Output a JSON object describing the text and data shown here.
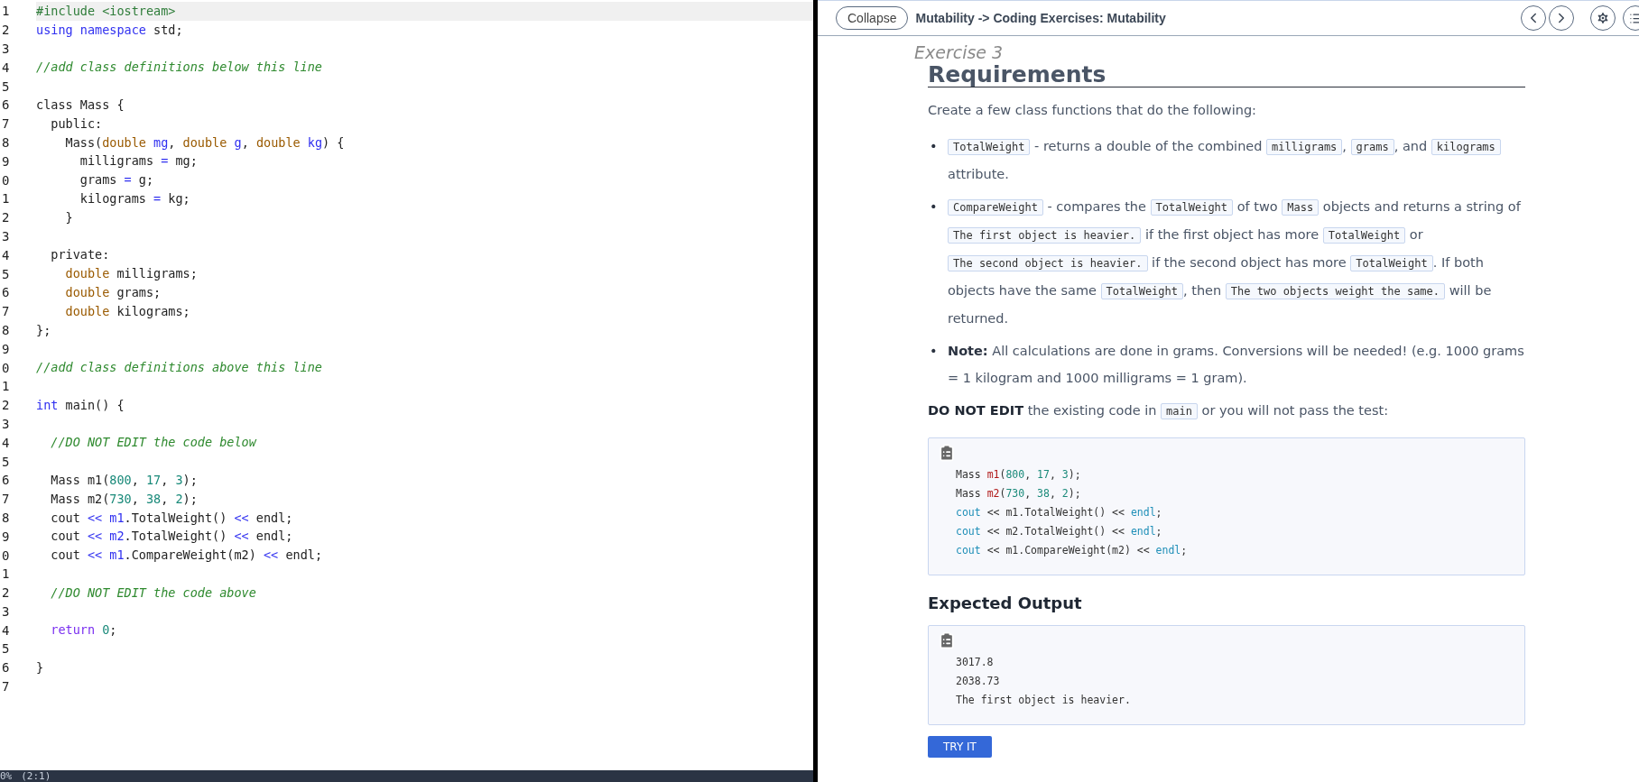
{
  "editor": {
    "lines": [
      {
        "number": "1",
        "highlighted": true,
        "tokens": [
          {
            "kind": "meta",
            "text": "#include <iostream>"
          }
        ]
      },
      {
        "number": "2",
        "highlighted": false,
        "tokens": [
          {
            "kind": "keyword",
            "text": "using namespace"
          },
          {
            "kind": "plain",
            "text": " std;"
          }
        ]
      },
      {
        "number": "3",
        "highlighted": false
      },
      {
        "number": "4",
        "highlighted": false,
        "tokens": [
          {
            "kind": "comment",
            "text": "//add class definitions below this line"
          }
        ]
      },
      {
        "number": "5",
        "highlighted": false
      },
      {
        "number": "6",
        "highlighted": false,
        "tokens": [
          {
            "kind": "plain",
            "text": "class Mass {"
          }
        ]
      },
      {
        "number": "7",
        "highlighted": false,
        "tokens": [
          {
            "kind": "plain",
            "text": "  public:"
          }
        ]
      },
      {
        "number": "8",
        "highlighted": false,
        "tokens": [
          {
            "kind": "plain",
            "text": "    Mass("
          },
          {
            "kind": "type",
            "text": "double"
          },
          {
            "kind": "keyword",
            "text": " mg"
          },
          {
            "kind": "plain",
            "text": ", "
          },
          {
            "kind": "type",
            "text": "double"
          },
          {
            "kind": "keyword",
            "text": " g"
          },
          {
            "kind": "plain",
            "text": ", "
          },
          {
            "kind": "type",
            "text": "double"
          },
          {
            "kind": "keyword",
            "text": " kg"
          },
          {
            "kind": "plain",
            "text": ") {"
          }
        ]
      },
      {
        "number": "9",
        "highlighted": false,
        "tokens": [
          {
            "kind": "plain",
            "text": "      milligrams "
          },
          {
            "kind": "keyword",
            "text": "="
          },
          {
            "kind": "plain",
            "text": " mg;"
          }
        ]
      },
      {
        "number": "0",
        "highlighted": false,
        "tokens": [
          {
            "kind": "plain",
            "text": "      grams "
          },
          {
            "kind": "keyword",
            "text": "="
          },
          {
            "kind": "plain",
            "text": " g;"
          }
        ]
      },
      {
        "number": "1",
        "highlighted": false,
        "tokens": [
          {
            "kind": "plain",
            "text": "      kilograms "
          },
          {
            "kind": "keyword",
            "text": "="
          },
          {
            "kind": "plain",
            "text": " kg;"
          }
        ]
      },
      {
        "number": "2",
        "highlighted": false,
        "tokens": [
          {
            "kind": "plain",
            "text": "    }"
          }
        ]
      },
      {
        "number": "3",
        "highlighted": false
      },
      {
        "number": "4",
        "highlighted": false,
        "tokens": [
          {
            "kind": "plain",
            "text": "  private:"
          }
        ]
      },
      {
        "number": "5",
        "highlighted": false,
        "tokens": [
          {
            "kind": "type",
            "text": "    double"
          },
          {
            "kind": "plain",
            "text": " milligrams;"
          }
        ]
      },
      {
        "number": "6",
        "highlighted": false,
        "tokens": [
          {
            "kind": "type",
            "text": "    double"
          },
          {
            "kind": "plain",
            "text": " grams;"
          }
        ]
      },
      {
        "number": "7",
        "highlighted": false,
        "tokens": [
          {
            "kind": "type",
            "text": "    double"
          },
          {
            "kind": "plain",
            "text": " kilograms;"
          }
        ]
      },
      {
        "number": "8",
        "highlighted": false,
        "tokens": [
          {
            "kind": "plain",
            "text": "};"
          }
        ]
      },
      {
        "number": "9",
        "highlighted": false
      },
      {
        "number": "0",
        "highlighted": false,
        "tokens": [
          {
            "kind": "comment",
            "text": "//add class definitions above this line"
          }
        ]
      },
      {
        "number": "1",
        "highlighted": false
      },
      {
        "number": "2",
        "highlighted": false,
        "tokens": [
          {
            "kind": "keyword",
            "text": "int"
          },
          {
            "kind": "plain",
            "text": " main() {"
          }
        ]
      },
      {
        "number": "3",
        "highlighted": false
      },
      {
        "number": "4",
        "highlighted": false,
        "tokens": [
          {
            "kind": "comment",
            "text": "  //DO NOT EDIT the code below"
          }
        ]
      },
      {
        "number": "5",
        "highlighted": false
      },
      {
        "number": "6",
        "highlighted": false,
        "tokens": [
          {
            "kind": "plain",
            "text": "  Mass m1("
          },
          {
            "kind": "number",
            "text": "800"
          },
          {
            "kind": "plain",
            "text": ", "
          },
          {
            "kind": "number",
            "text": "17"
          },
          {
            "kind": "plain",
            "text": ", "
          },
          {
            "kind": "number",
            "text": "3"
          },
          {
            "kind": "plain",
            "text": ");"
          }
        ]
      },
      {
        "number": "7",
        "highlighted": false,
        "tokens": [
          {
            "kind": "plain",
            "text": "  Mass m2("
          },
          {
            "kind": "number",
            "text": "730"
          },
          {
            "kind": "plain",
            "text": ", "
          },
          {
            "kind": "number",
            "text": "38"
          },
          {
            "kind": "plain",
            "text": ", "
          },
          {
            "kind": "number",
            "text": "2"
          },
          {
            "kind": "plain",
            "text": ");"
          }
        ]
      },
      {
        "number": "8",
        "highlighted": false,
        "tokens": [
          {
            "kind": "plain",
            "text": "  cout "
          },
          {
            "kind": "keyword",
            "text": "<< m1"
          },
          {
            "kind": "plain",
            "text": ".TotalWeight() "
          },
          {
            "kind": "keyword",
            "text": "<<"
          },
          {
            "kind": "plain",
            "text": " endl;"
          }
        ]
      },
      {
        "number": "9",
        "highlighted": false,
        "tokens": [
          {
            "kind": "plain",
            "text": "  cout "
          },
          {
            "kind": "keyword",
            "text": "<< m2"
          },
          {
            "kind": "plain",
            "text": ".TotalWeight() "
          },
          {
            "kind": "keyword",
            "text": "<<"
          },
          {
            "kind": "plain",
            "text": " endl;"
          }
        ]
      },
      {
        "number": "0",
        "highlighted": false,
        "tokens": [
          {
            "kind": "plain",
            "text": "  cout "
          },
          {
            "kind": "keyword",
            "text": "<< m1"
          },
          {
            "kind": "plain",
            "text": ".CompareWeight(m2) "
          },
          {
            "kind": "keyword",
            "text": "<<"
          },
          {
            "kind": "plain",
            "text": " endl;"
          }
        ]
      },
      {
        "number": "1",
        "highlighted": false
      },
      {
        "number": "2",
        "highlighted": false,
        "tokens": [
          {
            "kind": "comment",
            "text": "  //DO NOT EDIT the code above"
          }
        ]
      },
      {
        "number": "3",
        "highlighted": false
      },
      {
        "number": "4",
        "highlighted": false,
        "tokens": [
          {
            "kind": "control",
            "text": "  return"
          },
          {
            "kind": "number",
            "text": " 0"
          },
          {
            "kind": "plain",
            "text": ";"
          }
        ]
      },
      {
        "number": "5",
        "highlighted": false
      },
      {
        "number": "6",
        "highlighted": false,
        "tokens": [
          {
            "kind": "plain",
            "text": "}"
          }
        ]
      },
      {
        "number": "7",
        "highlighted": false
      }
    ],
    "status_bar": {
      "zoom": "0%",
      "position": "(2:1)"
    }
  },
  "guide": {
    "collapse_button": "Collapse",
    "title": "Mutability -> Coding Exercises: Mutability",
    "exercise_label": "Exercise 3",
    "heading": "Requirements",
    "intro": "Create a few class functions that do the following:",
    "bullets": [
      {
        "marker": "•",
        "segments": [
          {
            "kind": "code",
            "text": "TotalWeight"
          },
          {
            "kind": "text",
            "text": " - returns a double of the combined "
          },
          {
            "kind": "code",
            "text": "milligrams"
          },
          {
            "kind": "text",
            "text": ", "
          },
          {
            "kind": "code",
            "text": "grams"
          },
          {
            "kind": "text",
            "text": ", and "
          },
          {
            "kind": "code",
            "text": "kilograms"
          },
          {
            "kind": "text",
            "text": " attribute."
          }
        ]
      },
      {
        "marker": "•",
        "segments": [
          {
            "kind": "code",
            "text": "CompareWeight"
          },
          {
            "kind": "text",
            "text": " - compares the "
          },
          {
            "kind": "code",
            "text": "TotalWeight"
          },
          {
            "kind": "text",
            "text": " of two "
          },
          {
            "kind": "code",
            "text": "Mass"
          },
          {
            "kind": "text",
            "text": " objects and returns a string of "
          },
          {
            "kind": "code",
            "text": "The first object is heavier."
          },
          {
            "kind": "text",
            "text": " if the first object has more "
          },
          {
            "kind": "code",
            "text": "TotalWeight"
          },
          {
            "kind": "text",
            "text": " or "
          },
          {
            "kind": "code",
            "text": "The second object is heavier."
          },
          {
            "kind": "text",
            "text": " if the second object has more "
          },
          {
            "kind": "code",
            "text": "TotalWeight"
          },
          {
            "kind": "text",
            "text": ". If both objects have the same "
          },
          {
            "kind": "code",
            "text": "TotalWeight"
          },
          {
            "kind": "text",
            "text": ", then "
          },
          {
            "kind": "code",
            "text": "The two objects weight the same."
          },
          {
            "kind": "text",
            "text": " will be returned."
          }
        ]
      },
      {
        "marker": "•",
        "segments": [
          {
            "kind": "text",
            "text": "**Note:** All calculations are done in grams. Conversions will be needed! (e.g. 1000 grams = 1 kilogram and 1000 milligrams = 1 gram)."
          }
        ]
      }
    ],
    "instruction": [
      {
        "kind": "text",
        "text": "**DO NOT EDIT** the existing code in "
      },
      {
        "kind": "code",
        "text": "main"
      },
      {
        "kind": "text",
        "text": " or you will not pass the test:"
      }
    ],
    "code_block": [
      [
        {
          "kind": "plain",
          "text": "Mass "
        },
        {
          "kind": "var",
          "text": "m1"
        },
        {
          "kind": "plain",
          "text": "("
        },
        {
          "kind": "number",
          "text": "800"
        },
        {
          "kind": "plain",
          "text": ", "
        },
        {
          "kind": "number",
          "text": "17"
        },
        {
          "kind": "plain",
          "text": ", "
        },
        {
          "kind": "number",
          "text": "3"
        },
        {
          "kind": "plain",
          "text": ");"
        }
      ],
      [
        {
          "kind": "plain",
          "text": "Mass "
        },
        {
          "kind": "var",
          "text": "m2"
        },
        {
          "kind": "plain",
          "text": "("
        },
        {
          "kind": "number",
          "text": "730"
        },
        {
          "kind": "plain",
          "text": ", "
        },
        {
          "kind": "number",
          "text": "38"
        },
        {
          "kind": "plain",
          "text": ", "
        },
        {
          "kind": "number",
          "text": "2"
        },
        {
          "kind": "plain",
          "text": ");"
        }
      ],
      [
        {
          "kind": "builtin",
          "text": "cout"
        },
        {
          "kind": "plain",
          "text": " << m1.TotalWeight() << "
        },
        {
          "kind": "builtin",
          "text": "endl"
        },
        {
          "kind": "plain",
          "text": ";"
        }
      ],
      [
        {
          "kind": "builtin",
          "text": "cout"
        },
        {
          "kind": "plain",
          "text": " << m2.TotalWeight() << "
        },
        {
          "kind": "builtin",
          "text": "endl"
        },
        {
          "kind": "plain",
          "text": ";"
        }
      ],
      [
        {
          "kind": "builtin",
          "text": "cout"
        },
        {
          "kind": "plain",
          "text": " << m1.CompareWeight(m2) << "
        },
        {
          "kind": "builtin",
          "text": "endl"
        },
        {
          "kind": "plain",
          "text": ";"
        }
      ]
    ],
    "output_heading": "Expected Output",
    "output_lines": [
      "3017.8",
      "2038.73",
      "The first object is heavier."
    ],
    "try_button": "TRY IT"
  }
}
